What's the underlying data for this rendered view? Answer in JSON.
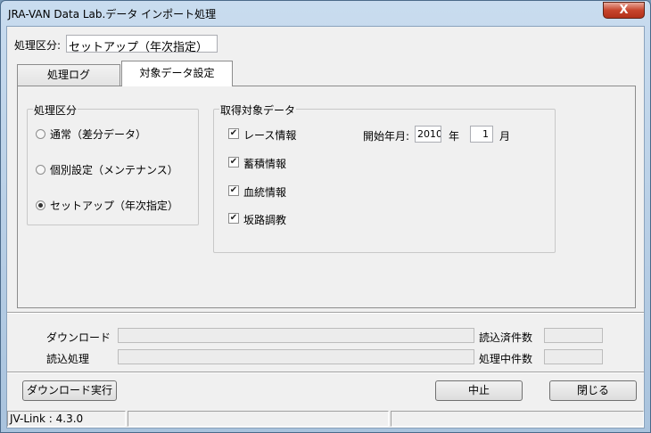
{
  "window": {
    "title": "JRA-VAN Data Lab.データ インポート処理",
    "close_label": "X"
  },
  "process_type": {
    "label": "処理区分:",
    "value": "セットアップ（年次指定）"
  },
  "tabs": [
    {
      "label": "処理ログ",
      "active": false
    },
    {
      "label": "対象データ設定",
      "active": true
    }
  ],
  "mode_group": {
    "title": "処理区分",
    "options": [
      {
        "label": "通常（差分データ）",
        "checked": false
      },
      {
        "label": "個別設定（メンテナンス）",
        "checked": false
      },
      {
        "label": "セットアップ（年次指定）",
        "checked": true
      }
    ]
  },
  "data_group": {
    "title": "取得対象データ",
    "items": [
      {
        "label": "レース情報",
        "checked": true
      },
      {
        "label": "蓄積情報",
        "checked": true
      },
      {
        "label": "血統情報",
        "checked": true
      },
      {
        "label": "坂路調教",
        "checked": true
      }
    ],
    "start_label": "開始年月:",
    "year_value": "2010",
    "year_unit": "年",
    "month_value": "1",
    "month_unit": "月"
  },
  "progress": {
    "download_label": "ダウンロード",
    "read_label": "読込処理",
    "read_count_label": "読込済件数",
    "processing_count_label": "処理中件数"
  },
  "buttons": {
    "download": "ダウンロード実行",
    "stop": "中止",
    "close": "閉じる"
  },
  "status": {
    "version": "JV-Link : 4.3.0"
  }
}
